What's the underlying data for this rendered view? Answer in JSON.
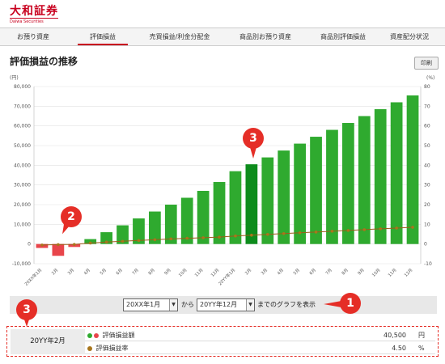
{
  "brand": {
    "name": "大和証券",
    "tagline": "Daiwa Securities"
  },
  "tabs": [
    {
      "label": "お預り資産",
      "active": false
    },
    {
      "label": "評価損益",
      "active": true
    },
    {
      "label": "売買損益/利金分配金",
      "active": false
    },
    {
      "label": "商品別お預り資産",
      "active": false
    },
    {
      "label": "商品別評価損益",
      "active": false
    },
    {
      "label": "資産配分状況",
      "active": false
    }
  ],
  "page": {
    "title": "評価損益の推移",
    "print_label": "印刷"
  },
  "chart_data": {
    "type": "bar",
    "left_unit": "(円)",
    "right_unit": "(%)",
    "categories": [
      "20XX年1月",
      "2月",
      "3月",
      "4月",
      "5月",
      "6月",
      "7月",
      "8月",
      "9月",
      "10月",
      "11月",
      "12月",
      "20YY年1月",
      "2月",
      "3月",
      "4月",
      "5月",
      "6月",
      "7月",
      "8月",
      "9月",
      "10月",
      "11月",
      "12月"
    ],
    "series": [
      {
        "axis": "left",
        "chart": "bar",
        "values": [
          -2000,
          -6000,
          -1500,
          2500,
          6000,
          9500,
          13000,
          16500,
          20000,
          23500,
          27000,
          31500,
          37000,
          40500,
          44000,
          47500,
          51000,
          54500,
          58000,
          61500,
          65000,
          68500,
          72000,
          75500
        ]
      },
      {
        "axis": "right",
        "chart": "line",
        "values": [
          -0.5,
          -0.3,
          -0.2,
          0.5,
          1.0,
          1.4,
          1.8,
          2.2,
          2.6,
          2.9,
          3.2,
          3.5,
          4.1,
          4.5,
          4.9,
          5.3,
          5.7,
          6.1,
          6.5,
          6.9,
          7.3,
          7.7,
          8.1,
          8.5
        ]
      }
    ],
    "y_left": {
      "min": -10000,
      "max": 80000,
      "ticks": [
        "80,000",
        "70,000",
        "60,000",
        "50,000",
        "40,000",
        "30,000",
        "20,000",
        "10,000",
        "0",
        "-10,000"
      ]
    },
    "y_right": {
      "min": -10,
      "max": 80,
      "ticks": [
        "80",
        "70",
        "60",
        "50",
        "40",
        "30",
        "20",
        "10",
        "0",
        "-10"
      ]
    },
    "selected_index": 13,
    "colors": {
      "bar": "#2faa2f",
      "bar_selected": "#0d8c1c",
      "bar_negative": "#e8454b",
      "line": "#9c5b1a",
      "marker": "#a8761c"
    },
    "grid": true
  },
  "range": {
    "from_value": "20XX年1月",
    "from_label": "から",
    "to_value": "20YY年12月",
    "to_label": "までのグラフを表示"
  },
  "callouts": {
    "c1": "1",
    "c2": "2",
    "c3": "3"
  },
  "detail": {
    "month": "20YY年2月",
    "amount_label": "評価損益額",
    "amount_value": "40,500",
    "amount_unit": "円",
    "rate_label": "評価損益率",
    "rate_value": "4.50",
    "rate_unit": "%",
    "colors": {
      "dot_green": "#2faa2f",
      "dot_red": "#e8454b",
      "dot_brown": "#a8761c"
    }
  }
}
